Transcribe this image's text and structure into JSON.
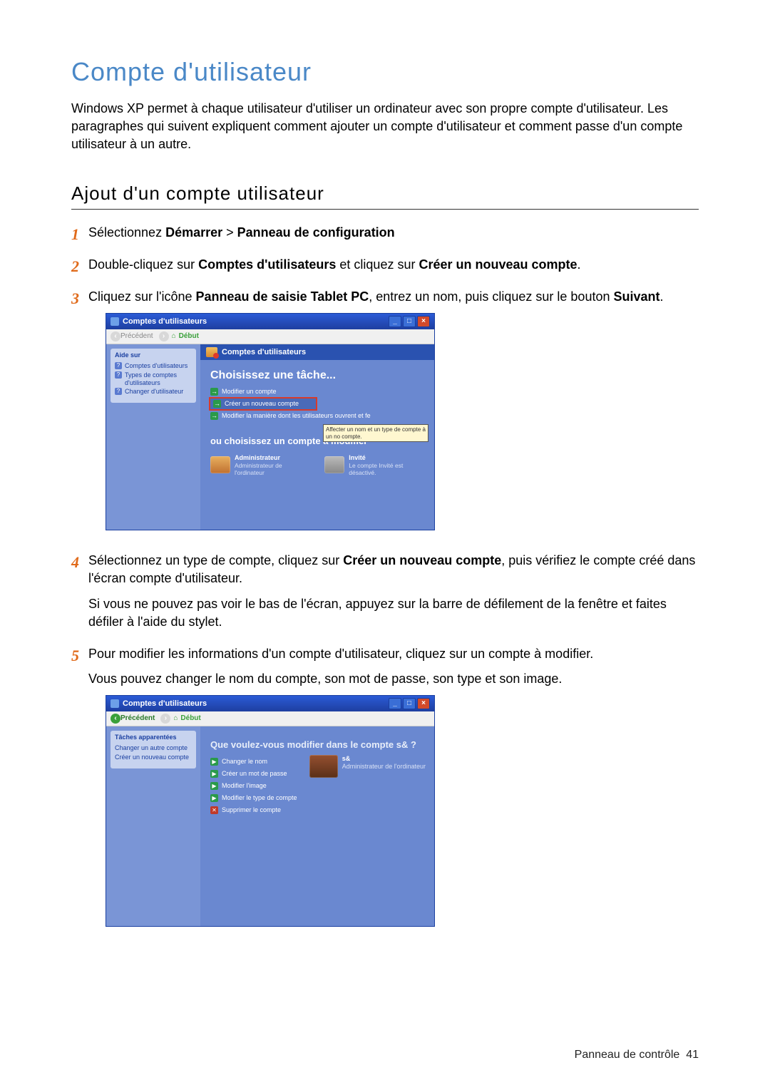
{
  "title": "Compte d'utilisateur",
  "intro": "Windows XP permet à chaque utilisateur d'utiliser un ordinateur avec son propre compte d'utilisateur. Les paragraphes qui suivent expliquent comment ajouter un compte d'utilisateur et comment passe d'un compte utilisateur à un autre.",
  "subtitle": "Ajout d'un compte utilisateur",
  "steps": {
    "s1": {
      "pre": "Sélectionnez ",
      "b1": "Démarrer",
      "mid": " > ",
      "b2": "Panneau de configuration"
    },
    "s2": {
      "pre": "Double-cliquez sur ",
      "b1": "Comptes d'utilisateurs",
      "mid": " et cliquez sur ",
      "b2": "Créer un nouveau compte",
      "post": "."
    },
    "s3": {
      "pre": "Cliquez sur l'icône ",
      "b1": "Panneau de saisie Tablet PC",
      "mid": ", entrez un nom, puis cliquez sur le bouton ",
      "b2": "Suivant",
      "post": "."
    },
    "s4": {
      "p1a": "Sélectionnez un type de compte, cliquez sur ",
      "p1b": "Créer un nouveau compte",
      "p1c": ", puis vérifiez le compte créé dans l'écran compte d'utilisateur.",
      "p2": "Si vous ne pouvez pas voir le bas de l'écran, appuyez sur la barre de défilement de la fenêtre et faites défiler à l'aide du stylet."
    },
    "s5": {
      "p1": "Pour modifier les informations d'un compte d'utilisateur, cliquez sur un compte à modifier.",
      "p2": "Vous pouvez changer le nom du compte, son mot de passe, son type et son image."
    }
  },
  "shot1": {
    "title": "Comptes d'utilisateurs",
    "toolbar": {
      "back": "Précédent",
      "home": "Début"
    },
    "side": {
      "head": "Aide sur",
      "items": [
        "Comptes d'utilisateurs",
        "Types de comptes d'utilisateurs",
        "Changer d'utilisateur"
      ]
    },
    "banner": "Comptes d'utilisateurs",
    "task_head": "Choisissez une tâche...",
    "tasks": {
      "t1": "Modifier un compte",
      "t2": "Créer un nouveau compte",
      "t3": "Modifier la manière dont les utilisateurs ouvrent et fe"
    },
    "tooltip": "Affecter un nom et un type de compte à un no compte.",
    "or_head": "ou choisissez un compte à modifier",
    "acc1": {
      "name": "Administrateur",
      "desc": "Administrateur de l'ordinateur"
    },
    "acc2": {
      "name": "Invité",
      "desc": "Le compte Invité est désactivé."
    }
  },
  "shot2": {
    "title": "Comptes d'utilisateurs",
    "toolbar": {
      "back": "Précédent",
      "home": "Début"
    },
    "side": {
      "head": "Tâches apparentées",
      "items": [
        "Changer un autre compte",
        "Créer un nouveau compte"
      ]
    },
    "question": "Que voulez-vous modifier dans le compte s& ?",
    "actions": {
      "a1": "Changer le nom",
      "a2": "Créer un mot de passe",
      "a3": "Modifier l'image",
      "a4": "Modifier le type de compte",
      "a5": "Supprimer le compte"
    },
    "profile": {
      "name": "s&",
      "desc": "Administrateur de l'ordinateur"
    }
  },
  "footer": {
    "section": "Panneau de contrôle",
    "page": "41"
  }
}
